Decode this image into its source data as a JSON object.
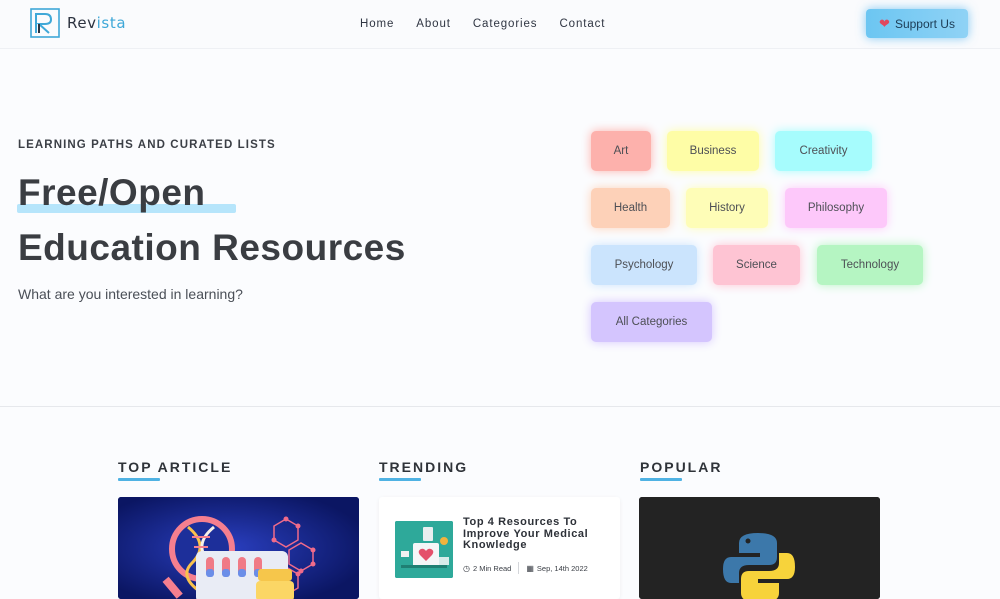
{
  "header": {
    "logo_text": "Rev",
    "logo_text_accent": "ista",
    "nav": [
      "Home",
      "About",
      "Categories",
      "Contact"
    ],
    "support_label": "Support Us",
    "support_icon": "heart-icon"
  },
  "hero": {
    "eyebrow": "LEARNING PATHS AND CURATED LISTS",
    "title_line1": "Free/Open",
    "title_line2": "Education Resources",
    "subtitle": "What are you interested in learning?"
  },
  "categories": [
    "Art",
    "Business",
    "Creativity",
    "Health",
    "History",
    "Philosophy",
    "Psychology",
    "Science",
    "Technology",
    "All Categories"
  ],
  "sections": {
    "top_article": "TOP ARTICLE",
    "trending": "TRENDING",
    "popular": "POPULAR"
  },
  "trending_card": {
    "title": "Top 4 Resources To Improve Your Medical Knowledge",
    "read_time": "2 Min Read",
    "date": "Sep, 14th 2022"
  },
  "colors": {
    "accent": "#4fb2e3",
    "support_button": "#7dcdf3",
    "top_card_bg": "#0d1a6e",
    "popular_card_bg": "#232323"
  }
}
